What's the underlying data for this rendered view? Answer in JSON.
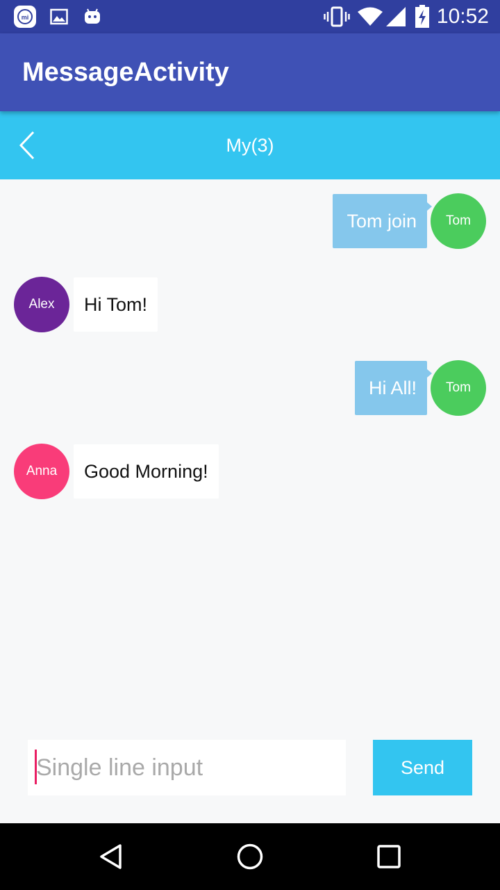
{
  "status_bar": {
    "time": "10:52",
    "left_icons": [
      "mi-app-icon",
      "gallery-icon",
      "android-icon"
    ],
    "right_icons": [
      "vibrate-icon",
      "wifi-icon",
      "signal-icon",
      "battery-charging-icon"
    ]
  },
  "app_bar": {
    "title": "MessageActivity",
    "color": "#3f51b5"
  },
  "chat_header": {
    "title": "My(3)",
    "back_icon": "chevron-left-icon",
    "color": "#33c5f0"
  },
  "messages": [
    {
      "side": "right",
      "sender": "Tom",
      "text": "Tom join",
      "avatar_color": "#4bcc5d"
    },
    {
      "side": "left",
      "sender": "Alex",
      "text": "Hi Tom!",
      "avatar_color": "#6b2598"
    },
    {
      "side": "right",
      "sender": "Tom",
      "text": "Hi All!",
      "avatar_color": "#4bcc5d"
    },
    {
      "side": "left",
      "sender": "Anna",
      "text": "Good Morning!",
      "avatar_color": "#f93c79"
    }
  ],
  "input_bar": {
    "placeholder": "Single line input",
    "send_label": "Send"
  },
  "nav_bar": {
    "icons": [
      "back-triangle-icon",
      "home-circle-icon",
      "recents-square-icon"
    ]
  }
}
